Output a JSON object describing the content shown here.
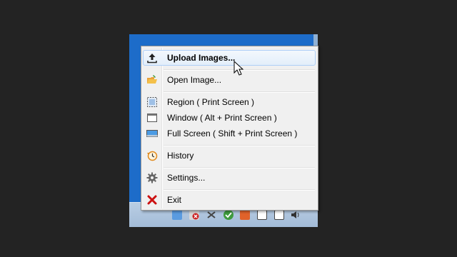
{
  "menu": {
    "items": [
      {
        "label": "Upload Images...",
        "icon": "upload-icon"
      },
      {
        "label": "Open Image...",
        "icon": "folder-open-icon"
      },
      {
        "label": "Region ( Print Screen )",
        "icon": "region-select-icon"
      },
      {
        "label": "Window ( Alt + Print Screen )",
        "icon": "window-icon"
      },
      {
        "label": "Full Screen ( Shift + Print Screen )",
        "icon": "monitor-icon"
      },
      {
        "label": "History",
        "icon": "history-clock-icon"
      },
      {
        "label": "Settings...",
        "icon": "gear-icon"
      },
      {
        "label": "Exit",
        "icon": "close-x-icon"
      }
    ],
    "highlighted_index": 0
  },
  "tray": {
    "icons": [
      "app-tray-icon",
      "network-error-icon",
      "tool-tray-icon",
      "security-check-icon",
      "folder-tray-icon",
      "clipboard-tray-icon",
      "monitor-tray-icon",
      "speaker-icon"
    ]
  },
  "colors": {
    "desktop": "#1d6cc9",
    "menu_bg": "#f0f0f0",
    "highlight_border": "#aecff7",
    "exit_red": "#cc1111"
  }
}
